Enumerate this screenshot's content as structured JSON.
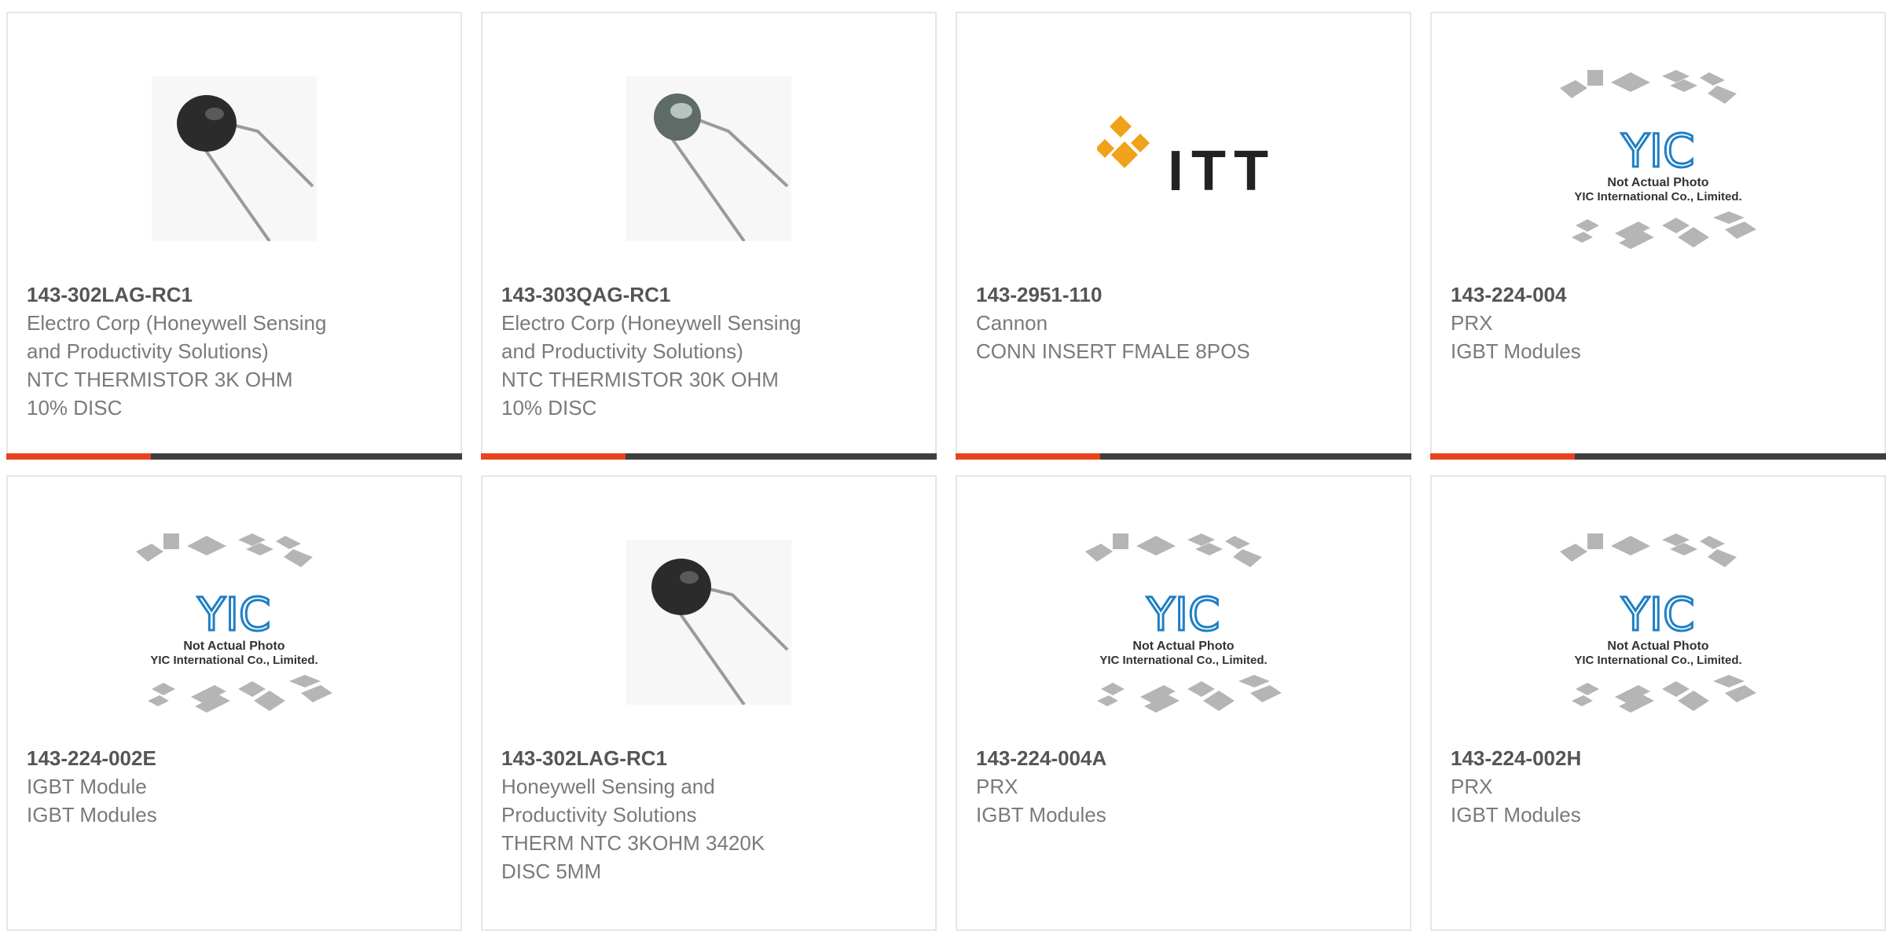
{
  "products": [
    {
      "part": "143-302LAG-RC1",
      "lines": [
        "Electro Corp (Honeywell Sensing",
        "and Productivity Solutions)",
        "NTC THERMISTOR 3K OHM",
        "10% DISC"
      ],
      "image": "thermistor-dark-photo"
    },
    {
      "part": "143-303QAG-RC1",
      "lines": [
        "Electro Corp (Honeywell Sensing",
        "and Productivity Solutions)",
        "NTC THERMISTOR 30K OHM",
        "10% DISC"
      ],
      "image": "thermistor-green-photo"
    },
    {
      "part": "143-2951-110",
      "lines": [
        "Cannon",
        "CONN INSERT FMALE 8POS"
      ],
      "image": "itt-logo",
      "logo_text": "ITT"
    },
    {
      "part": "143-224-004",
      "lines": [
        "PRX",
        "IGBT Modules"
      ],
      "image": "yic-placeholder",
      "logo_text": "YIC",
      "caption_1": "Not Actual Photo",
      "caption_2": "YIC International Co., Limited."
    },
    {
      "part": "143-224-002E",
      "lines": [
        "IGBT Module",
        "IGBT Modules"
      ],
      "image": "yic-placeholder",
      "logo_text": "YIC",
      "caption_1": "Not Actual Photo",
      "caption_2": "YIC International Co., Limited."
    },
    {
      "part": "143-302LAG-RC1",
      "lines": [
        "Honeywell Sensing and",
        "Productivity Solutions",
        "THERM NTC 3KOHM 3420K",
        "DISC 5MM"
      ],
      "image": "thermistor-dark-photo"
    },
    {
      "part": "143-224-004A",
      "lines": [
        "PRX",
        "IGBT Modules"
      ],
      "image": "yic-placeholder",
      "logo_text": "YIC",
      "caption_1": "Not Actual Photo",
      "caption_2": "YIC International Co., Limited."
    },
    {
      "part": "143-224-002H",
      "lines": [
        "PRX",
        "IGBT Modules"
      ],
      "image": "yic-placeholder",
      "logo_text": "YIC",
      "caption_1": "Not Actual Photo",
      "caption_2": "YIC International Co., Limited."
    }
  ],
  "colors": {
    "accent": "#e8431d",
    "bar": "#3f3f3f",
    "border": "#e6e6e6",
    "yic_blue": "#1f7fc4",
    "itt_orange": "#f0a21a"
  }
}
